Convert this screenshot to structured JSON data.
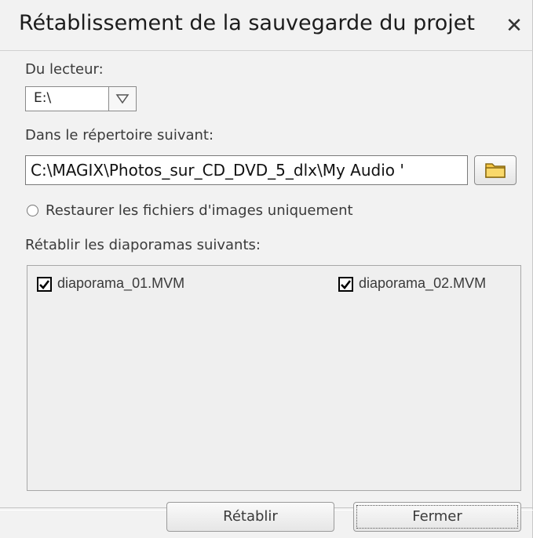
{
  "dialog": {
    "title": "Rétablissement de la sauvegarde du projet",
    "close_icon": "close-icon"
  },
  "drive": {
    "label": "Du lecteur:",
    "value": "E:\\"
  },
  "directory": {
    "label": "Dans le répertoire suivant:",
    "value": "C:\\MAGIX\\Photos_sur_CD_DVD_5_dlx\\My Audio '",
    "browse_icon": "folder-icon"
  },
  "restore_images_only": {
    "label": "Restaurer les fichiers d'images uniquement",
    "checked": false
  },
  "slideshows": {
    "label": "Rétablir les diaporamas suivants:",
    "items": [
      {
        "label": "diaporama_01.MVM",
        "checked": true
      },
      {
        "label": "diaporama_02.MVM",
        "checked": true
      }
    ]
  },
  "buttons": {
    "restore_label": "Rétablir",
    "close_label": "Fermer"
  },
  "colors": {
    "folder": "#f5c542",
    "background": "#f2f2f2"
  }
}
